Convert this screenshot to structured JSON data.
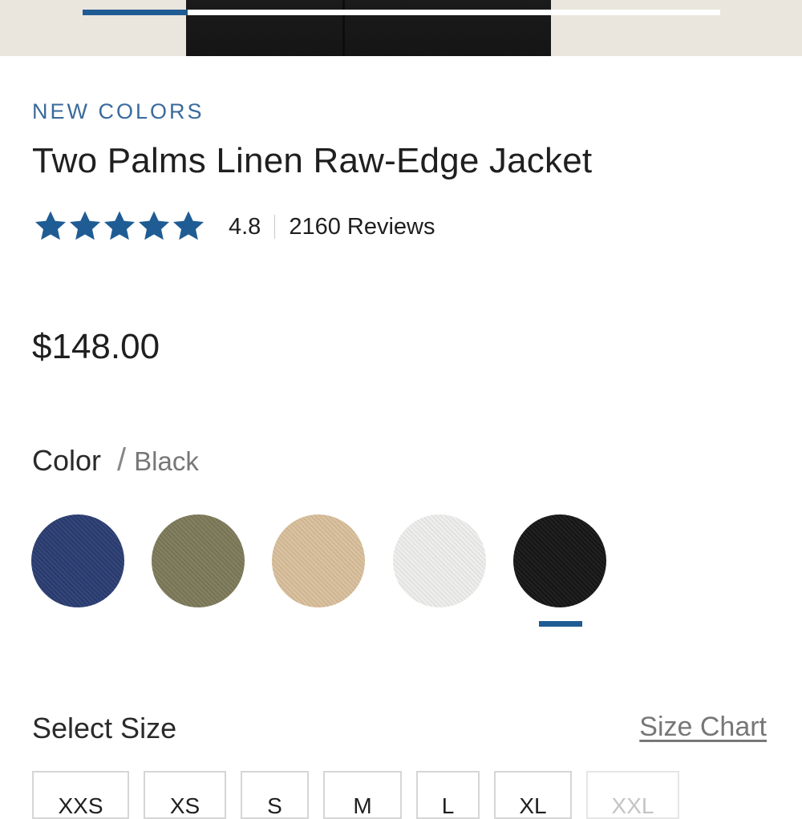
{
  "gallery": {
    "progress": 0.165
  },
  "product": {
    "badge": "NEW COLORS",
    "title": "Two Palms Linen Raw-Edge Jacket",
    "rating": {
      "stars": 5,
      "value": "4.8",
      "reviews": "2160 Reviews"
    },
    "price": "$148.00"
  },
  "color": {
    "label": "Color",
    "separator": "/",
    "selected": "Black",
    "swatches": [
      {
        "name": "navy",
        "hex": "#2a3d72"
      },
      {
        "name": "olive",
        "hex": "#7d7a5a"
      },
      {
        "name": "sand",
        "hex": "#d9bf9b"
      },
      {
        "name": "white",
        "hex": "#eeeeec"
      },
      {
        "name": "black",
        "hex": "#161616"
      }
    ],
    "selected_index": 4
  },
  "size": {
    "label": "Select Size",
    "chart_link": "Size Chart",
    "options": [
      "XXS",
      "XS",
      "S",
      "M",
      "L",
      "XL",
      "XXL"
    ],
    "unavailable": [
      "XXL"
    ]
  },
  "colors": {
    "accent": "#1f5c94",
    "star": "#1f5c94",
    "badge_text": "#3a6a9b"
  }
}
